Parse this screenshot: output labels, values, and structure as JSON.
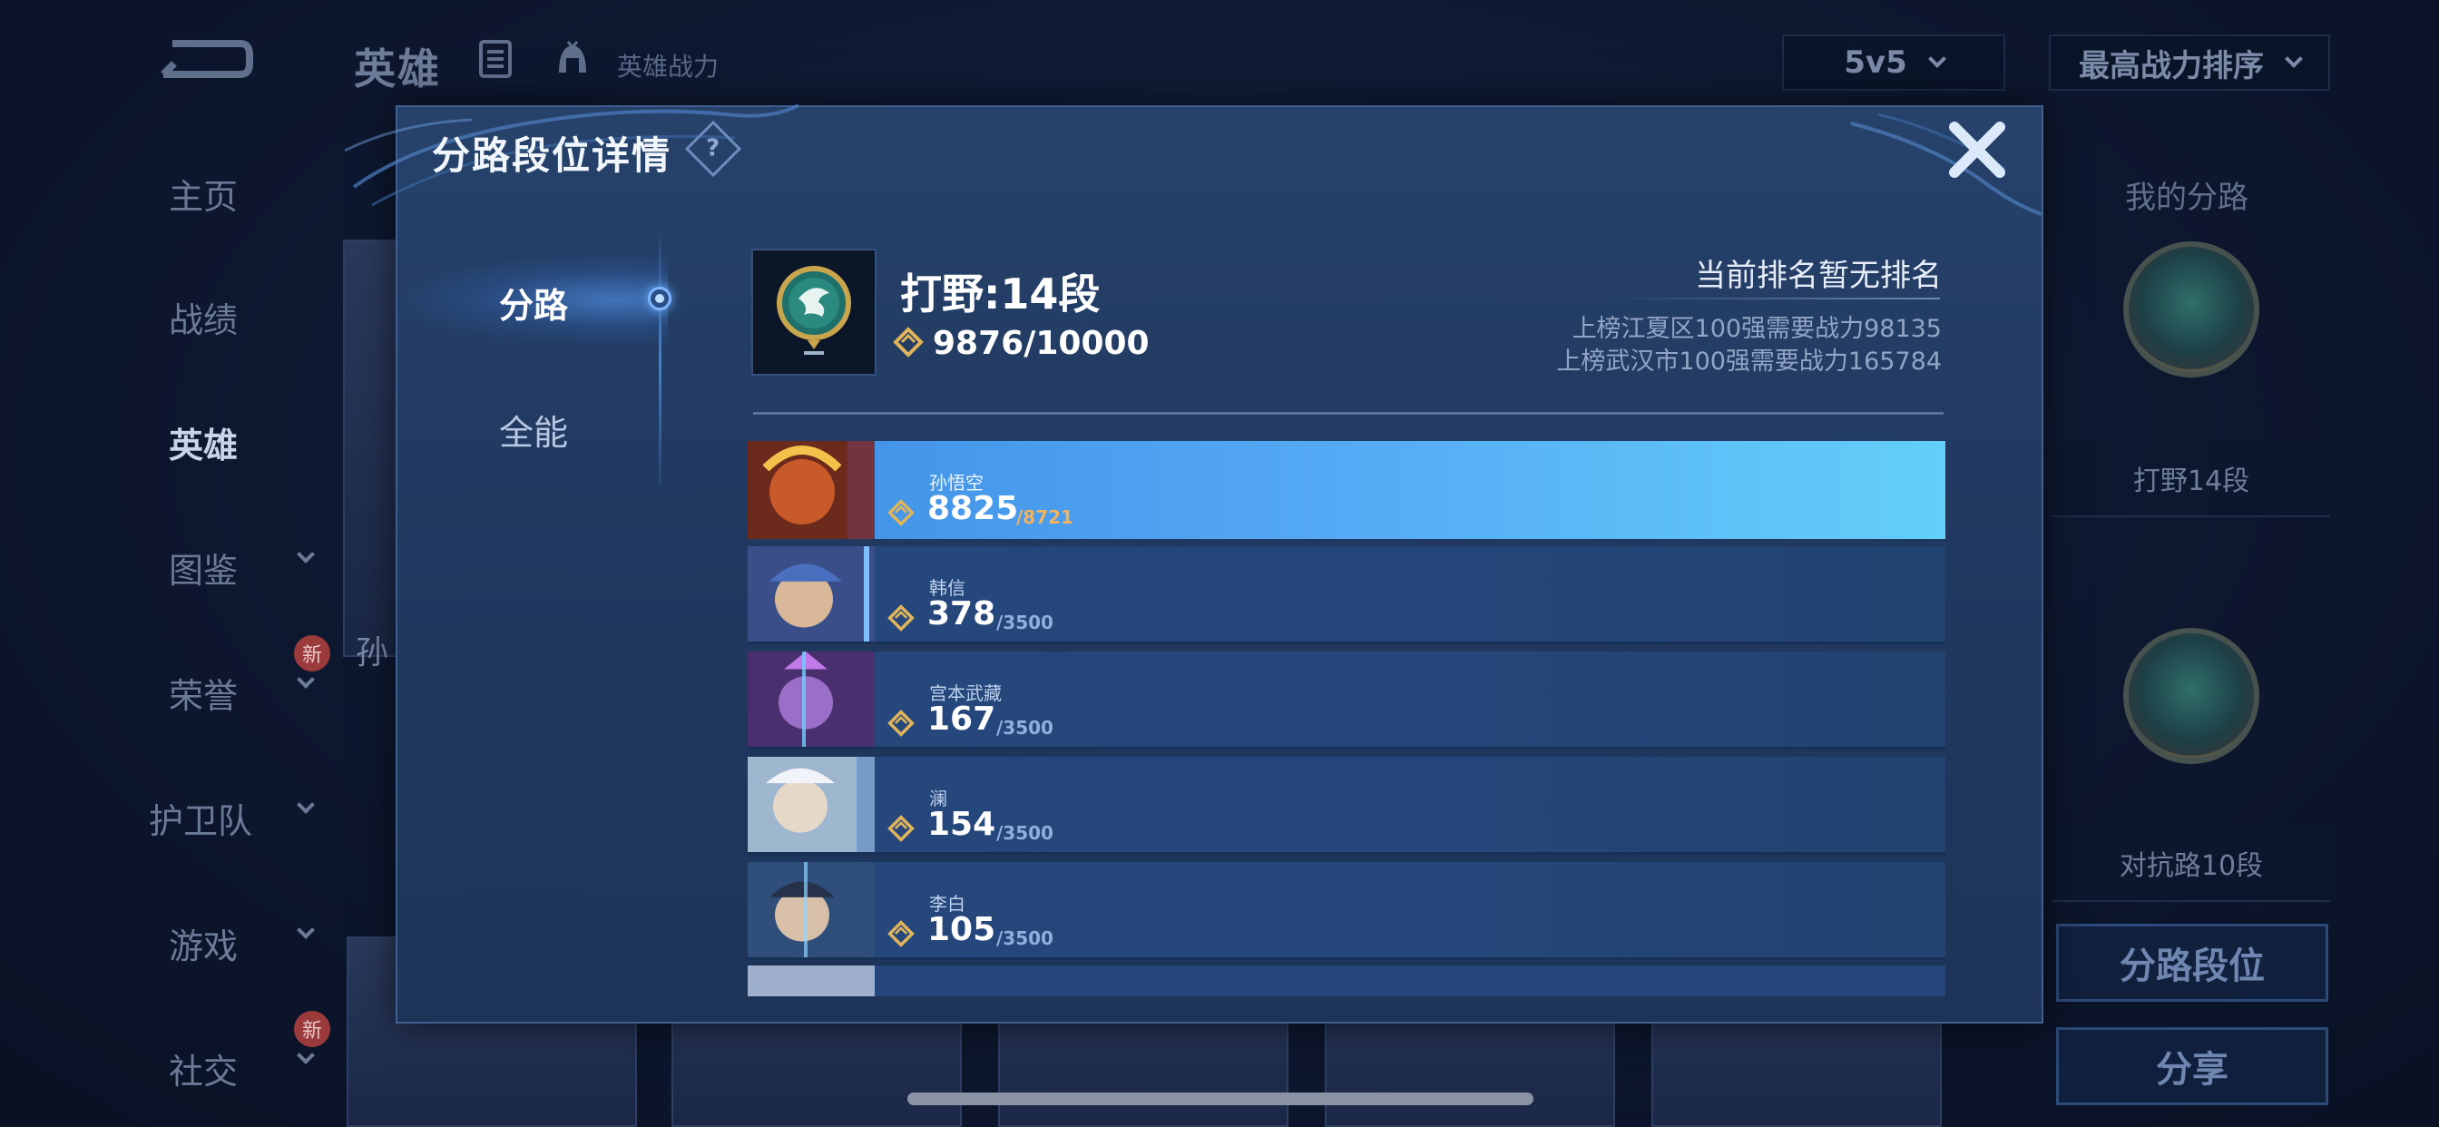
{
  "background": {
    "page_title": "英雄",
    "power_label": "英雄战力",
    "mode_dropdown": "5v5",
    "sort_dropdown": "最高战力排序",
    "sidebar": [
      {
        "label": "主页"
      },
      {
        "label": "战绩"
      },
      {
        "label": "英雄"
      },
      {
        "label": "图鉴"
      },
      {
        "label": "荣誉",
        "badge": "新"
      },
      {
        "label": "护卫队"
      },
      {
        "label": "游戏"
      },
      {
        "label": "社交",
        "badge": "新"
      }
    ],
    "hero_card_name": "孙",
    "right_panel": {
      "title": "我的分路",
      "lane1_label": "打野14段",
      "lane2_label": "对抗路10段",
      "lane_rank_button": "分路段位",
      "share_button": "分享"
    }
  },
  "modal": {
    "title": "分路段位详情",
    "help_icon_text": "?",
    "tabs": [
      {
        "label": "分路",
        "active": true
      },
      {
        "label": "全能",
        "active": false
      }
    ],
    "lane": {
      "title": "打野:14段",
      "power_current": "9876",
      "power_max": "10000",
      "power_text": "9876/10000"
    },
    "ranking": {
      "status": "当前排名暂无排名",
      "requirements": [
        "上榜江夏区100强需要战力98135",
        "上榜武汉市100强需要战力165784"
      ]
    },
    "heroes": [
      {
        "name": "孙悟空",
        "score": "8825",
        "target": "/8721",
        "highlight": true
      },
      {
        "name": "韩信",
        "score": "378",
        "target": "/3500",
        "highlight": false
      },
      {
        "name": "宫本武藏",
        "score": "167",
        "target": "/3500",
        "highlight": false
      },
      {
        "name": "澜",
        "score": "154",
        "target": "/3500",
        "highlight": false
      },
      {
        "name": "李白",
        "score": "105",
        "target": "/3500",
        "highlight": false
      }
    ]
  },
  "colors": {
    "accent_gold": "#f2b25e",
    "highlight_row": "#55aaf5",
    "modal_bg": "#213a61"
  }
}
